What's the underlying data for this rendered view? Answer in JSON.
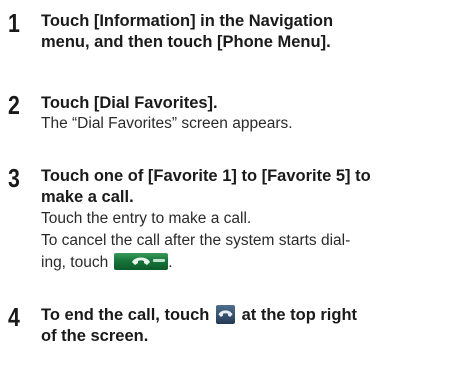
{
  "steps": [
    {
      "number": "1",
      "heading_line1": "Touch [Information] in the Navigation",
      "heading_line2": "menu, and then touch [Phone Menu]."
    },
    {
      "number": "2",
      "heading_line1": "Touch [Dial Favorites].",
      "body_line1": "The “Dial Favorites” screen appears."
    },
    {
      "number": "3",
      "heading_line1": "Touch one of [Favorite 1] to [Favorite 5] to",
      "heading_line2": "make a call.",
      "body_line1": "Touch the entry to make a call.",
      "body_line2": "To cancel the call after the system starts dial-",
      "body_line3": "ing, touch",
      "body_line3_end": "."
    },
    {
      "number": "4",
      "heading_line1_a": "To end the call, touch",
      "heading_line1_b": "at the top right",
      "heading_line2": "of the screen."
    }
  ],
  "icons": {
    "cancel_call": "end-call-handset-icon",
    "end_call": "end-call-handset-icon"
  },
  "colors": {
    "text": "#1a1a1a",
    "cancel_button_green": "#17753a",
    "end_call_button_blue": "#233a55"
  }
}
